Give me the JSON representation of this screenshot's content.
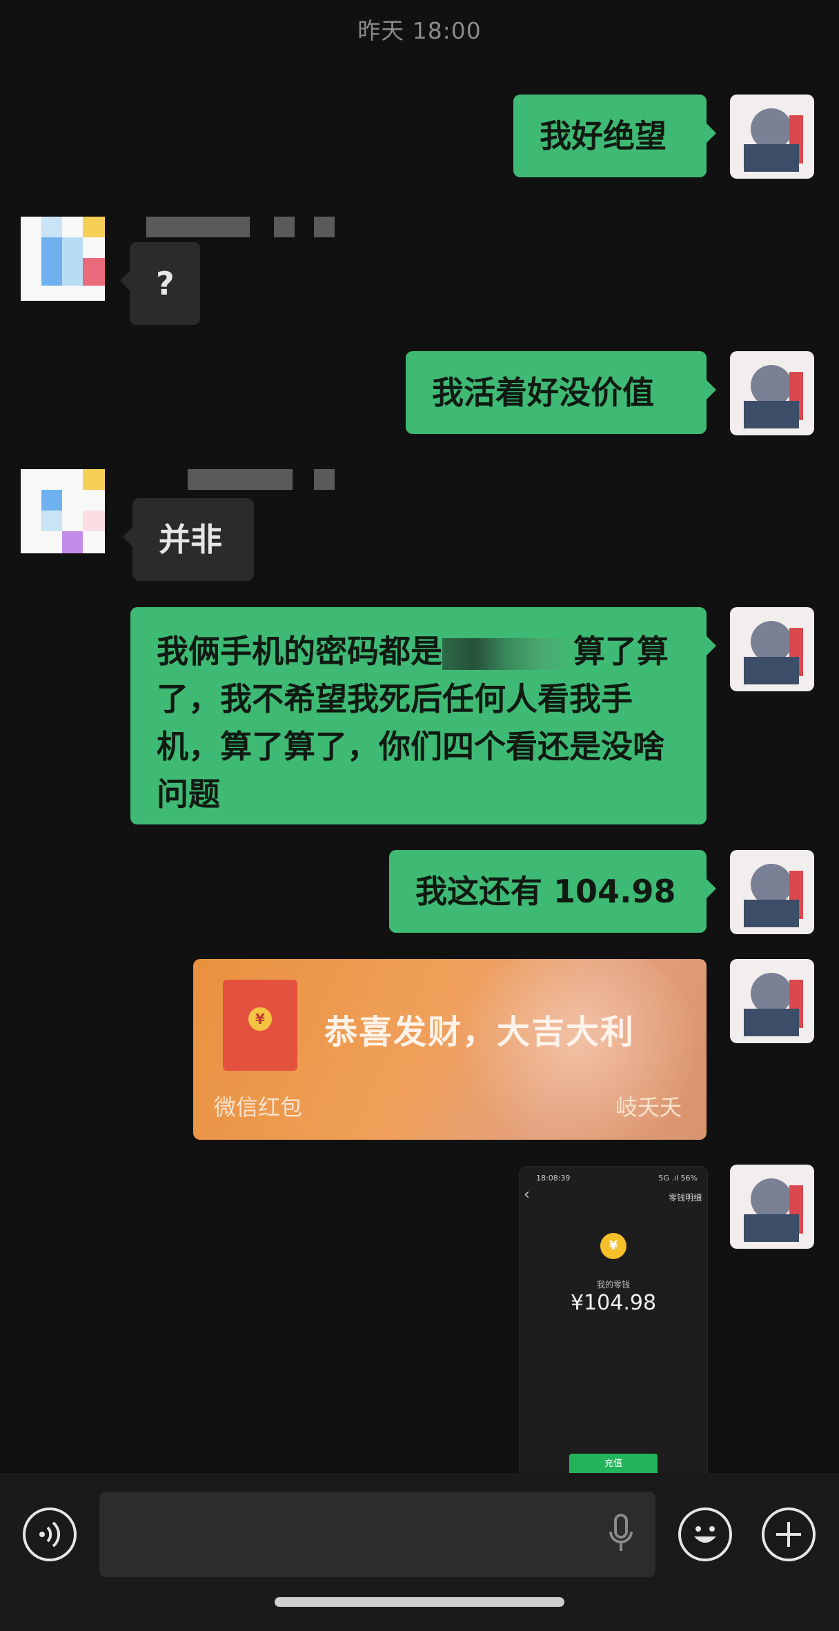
{
  "timestamp": "昨天 18:00",
  "messages": [
    {
      "from": "me",
      "text": "我好绝望"
    },
    {
      "from": "them",
      "text": "?"
    },
    {
      "from": "me",
      "text": "我活着好没价值"
    },
    {
      "from": "them",
      "text": "并非"
    },
    {
      "from": "me",
      "text_before": "我俩手机的密码都是",
      "text_after": "算了算了，我不希望我死后任何人看我手机，算了算了，你们四个看还是没啥问题"
    },
    {
      "from": "me",
      "text": "我这还有 104.98"
    }
  ],
  "red_packet": {
    "blessing": "恭喜发财，大吉大利",
    "label": "微信红包",
    "brand": "岐夭夭",
    "coin_symbol": "¥"
  },
  "screenshot": {
    "status_time": "18:08:39",
    "status_right": "5G .ıl 56%",
    "back": "‹",
    "detail": "零钱明细",
    "coin_symbol": "¥",
    "title": "我的零钱",
    "amount": "¥104.98",
    "button": "充值"
  },
  "colors": {
    "bubble_me": "#3fba74",
    "bubble_them": "#2b2b2b",
    "background": "#111111"
  },
  "icons": {
    "voice": "voice-mode-icon",
    "mic": "microphone-icon",
    "emoji": "emoji-icon",
    "plus": "plus-icon"
  }
}
